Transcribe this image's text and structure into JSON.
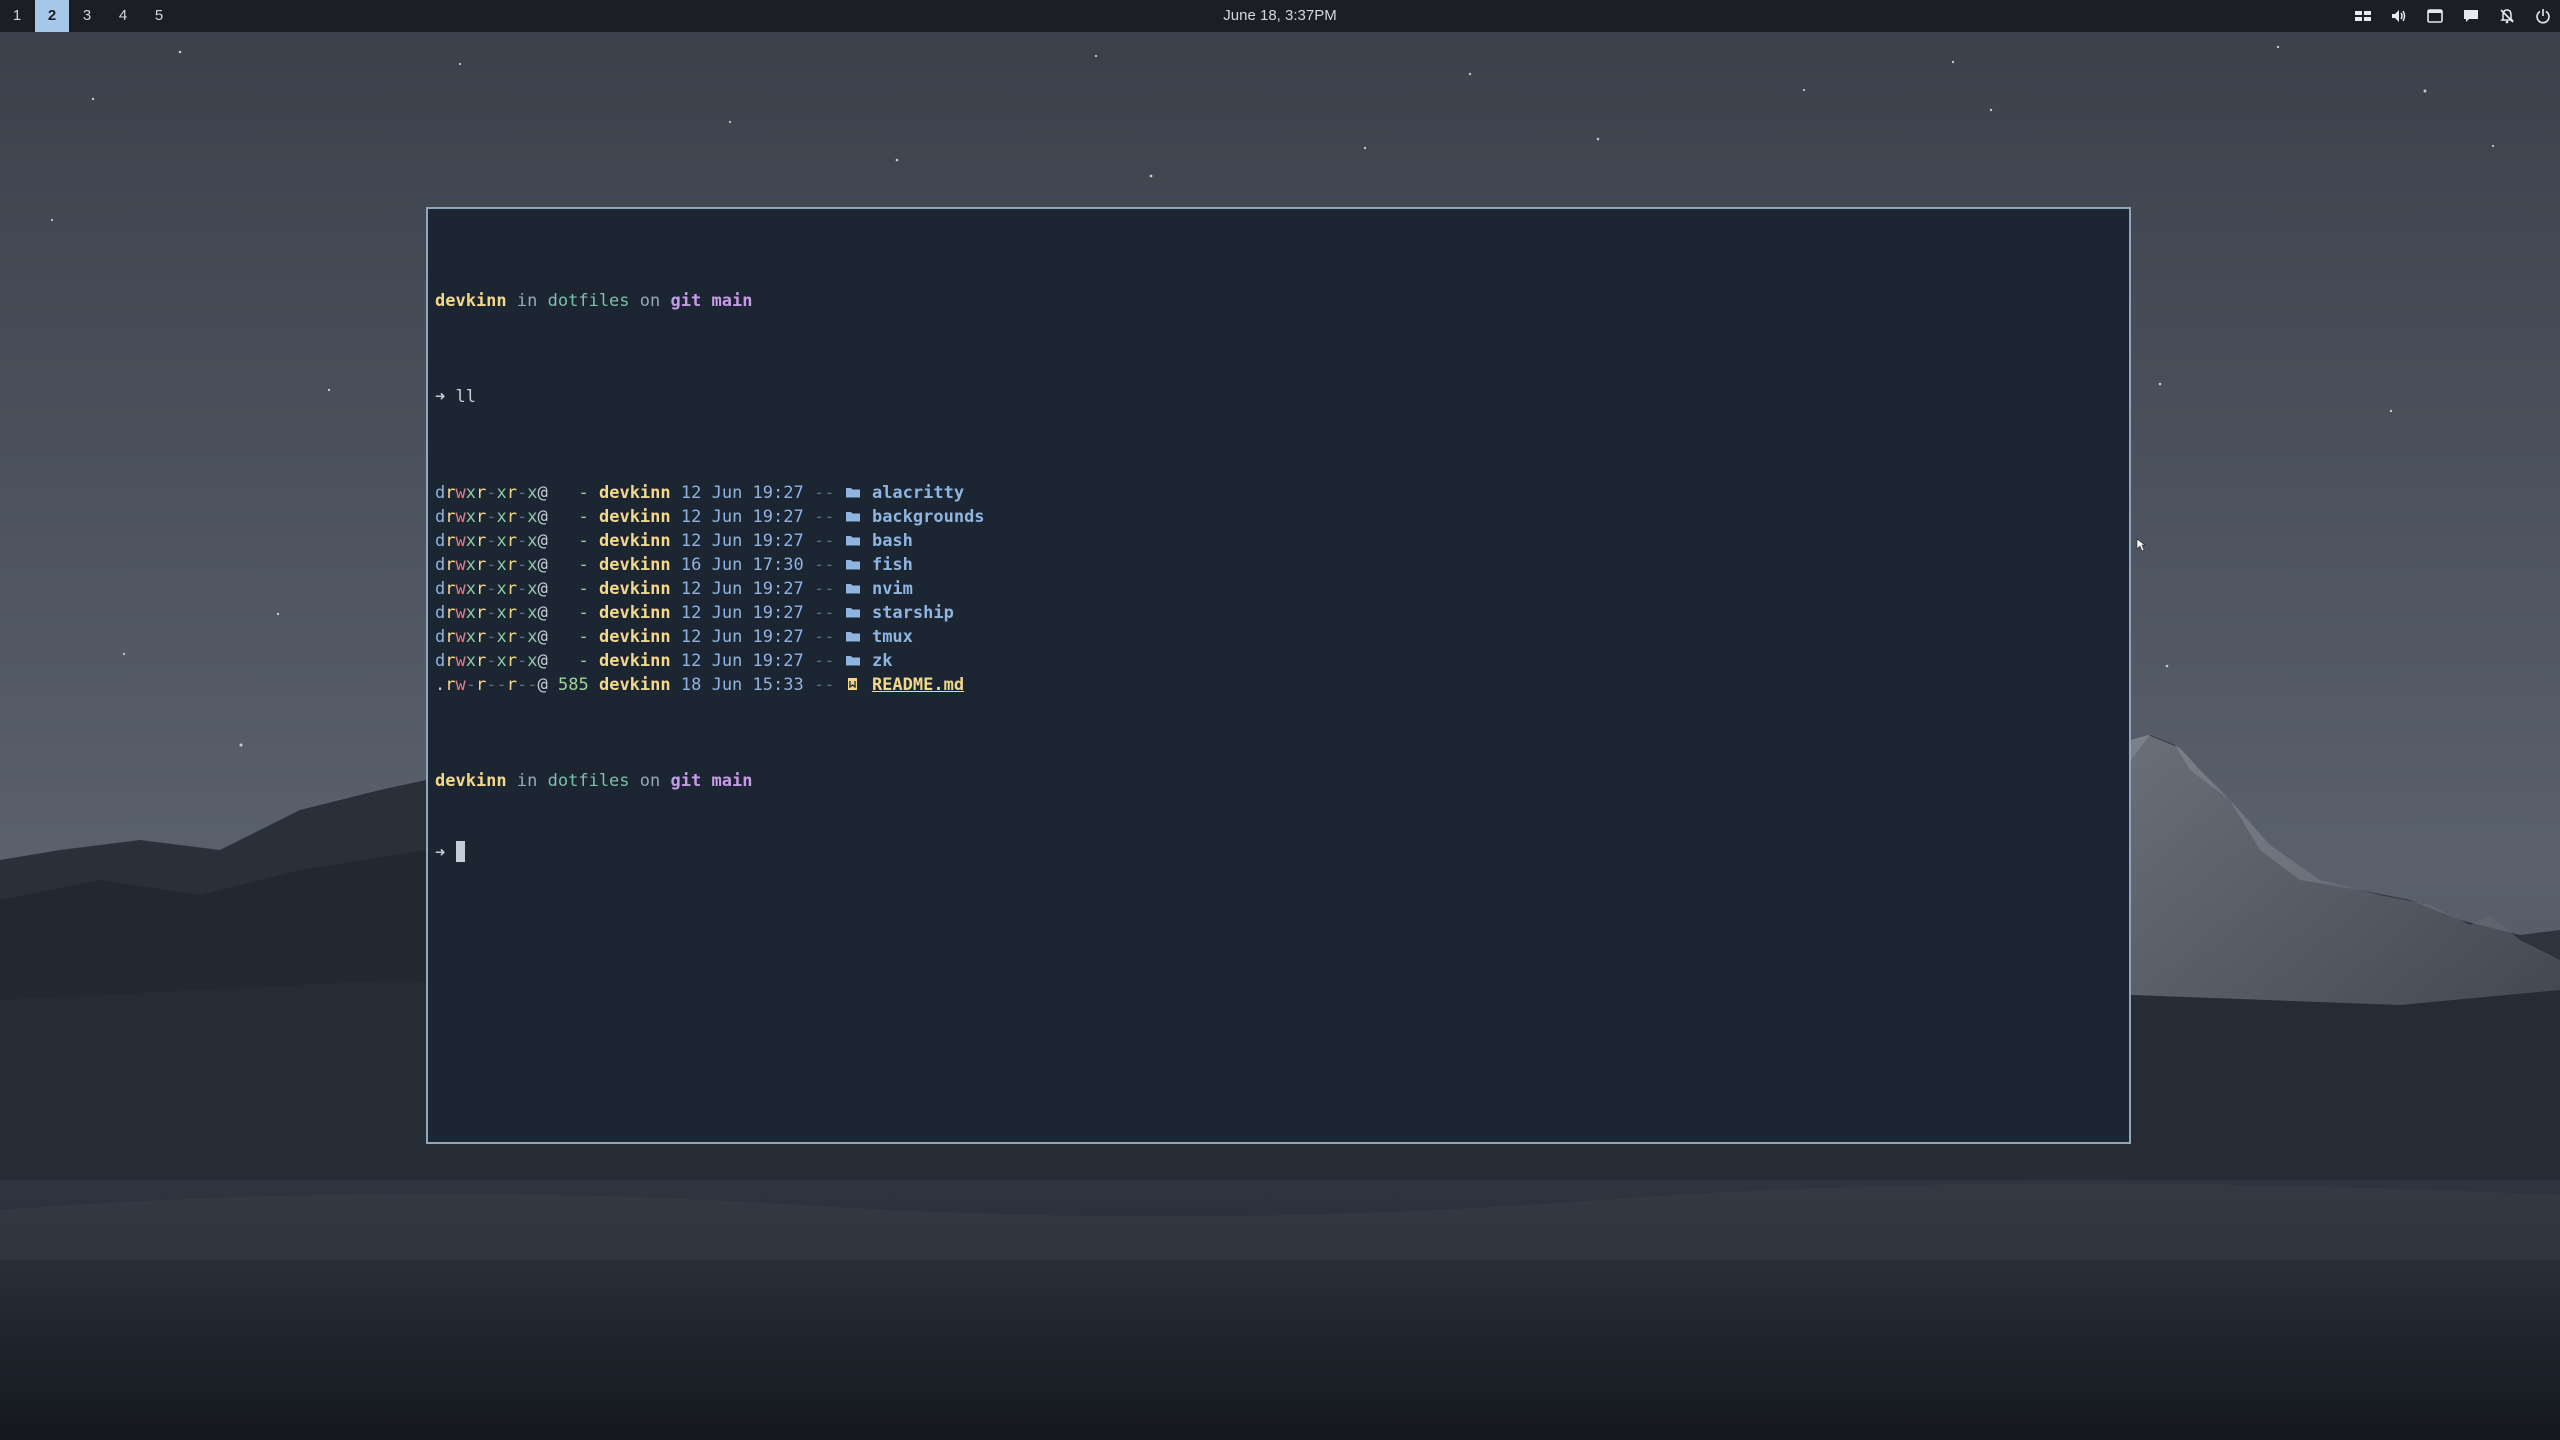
{
  "topbar": {
    "workspaces": [
      "1",
      "2",
      "3",
      "4",
      "5"
    ],
    "active_workspace": "2",
    "clock": "June 18, 3:37PM",
    "tray_icons": [
      "layout-icon",
      "volume-icon",
      "window-icon",
      "chat-icon",
      "notifications-off-icon",
      "power-icon"
    ]
  },
  "terminal": {
    "prompt1": {
      "user": "devkinn",
      "in": "in",
      "dir": "dotfiles",
      "on": "on",
      "git": "git",
      "branch": "main"
    },
    "command": {
      "arrow": "➜",
      "text": "ll"
    },
    "rows": [
      {
        "perm_d": "d",
        "perm_r1": "r",
        "perm_w": "w",
        "perm_x1": "x",
        "perm_r2": "r",
        "perm_dash2": "-",
        "perm_x2": "x",
        "perm_r3": "r",
        "perm_dash3": "-",
        "perm_x3": "x",
        "at": "@",
        "size": "-",
        "owner": "devkinn",
        "date": "12 Jun 19:27",
        "git": "--",
        "name": "alacritty",
        "kind": "dir"
      },
      {
        "perm_d": "d",
        "perm_r1": "r",
        "perm_w": "w",
        "perm_x1": "x",
        "perm_r2": "r",
        "perm_dash2": "-",
        "perm_x2": "x",
        "perm_r3": "r",
        "perm_dash3": "-",
        "perm_x3": "x",
        "at": "@",
        "size": "-",
        "owner": "devkinn",
        "date": "12 Jun 19:27",
        "git": "--",
        "name": "backgrounds",
        "kind": "dir"
      },
      {
        "perm_d": "d",
        "perm_r1": "r",
        "perm_w": "w",
        "perm_x1": "x",
        "perm_r2": "r",
        "perm_dash2": "-",
        "perm_x2": "x",
        "perm_r3": "r",
        "perm_dash3": "-",
        "perm_x3": "x",
        "at": "@",
        "size": "-",
        "owner": "devkinn",
        "date": "12 Jun 19:27",
        "git": "--",
        "name": "bash",
        "kind": "dir"
      },
      {
        "perm_d": "d",
        "perm_r1": "r",
        "perm_w": "w",
        "perm_x1": "x",
        "perm_r2": "r",
        "perm_dash2": "-",
        "perm_x2": "x",
        "perm_r3": "r",
        "perm_dash3": "-",
        "perm_x3": "x",
        "at": "@",
        "size": "-",
        "owner": "devkinn",
        "date": "16 Jun 17:30",
        "git": "--",
        "name": "fish",
        "kind": "dir"
      },
      {
        "perm_d": "d",
        "perm_r1": "r",
        "perm_w": "w",
        "perm_x1": "x",
        "perm_r2": "r",
        "perm_dash2": "-",
        "perm_x2": "x",
        "perm_r3": "r",
        "perm_dash3": "-",
        "perm_x3": "x",
        "at": "@",
        "size": "-",
        "owner": "devkinn",
        "date": "12 Jun 19:27",
        "git": "--",
        "name": "nvim",
        "kind": "dir"
      },
      {
        "perm_d": "d",
        "perm_r1": "r",
        "perm_w": "w",
        "perm_x1": "x",
        "perm_r2": "r",
        "perm_dash2": "-",
        "perm_x2": "x",
        "perm_r3": "r",
        "perm_dash3": "-",
        "perm_x3": "x",
        "at": "@",
        "size": "-",
        "owner": "devkinn",
        "date": "12 Jun 19:27",
        "git": "--",
        "name": "starship",
        "kind": "dir"
      },
      {
        "perm_d": "d",
        "perm_r1": "r",
        "perm_w": "w",
        "perm_x1": "x",
        "perm_r2": "r",
        "perm_dash2": "-",
        "perm_x2": "x",
        "perm_r3": "r",
        "perm_dash3": "-",
        "perm_x3": "x",
        "at": "@",
        "size": "-",
        "owner": "devkinn",
        "date": "12 Jun 19:27",
        "git": "--",
        "name": "tmux",
        "kind": "dir"
      },
      {
        "perm_d": "d",
        "perm_r1": "r",
        "perm_w": "w",
        "perm_x1": "x",
        "perm_r2": "r",
        "perm_dash2": "-",
        "perm_x2": "x",
        "perm_r3": "r",
        "perm_dash3": "-",
        "perm_x3": "x",
        "at": "@",
        "size": "-",
        "owner": "devkinn",
        "date": "12 Jun 19:27",
        "git": "--",
        "name": "zk",
        "kind": "dir"
      },
      {
        "perm_d": ".",
        "perm_r1": "r",
        "perm_w": "w",
        "perm_x1": "-",
        "perm_r2": "r",
        "perm_dash2": "-",
        "perm_x2": "-",
        "perm_r3": "r",
        "perm_dash3": "-",
        "perm_x3": "-",
        "at": "@",
        "size": "585",
        "owner": "devkinn",
        "date": "18 Jun 15:33",
        "git": "--",
        "name": "README.md",
        "kind": "file"
      }
    ],
    "prompt2": {
      "user": "devkinn",
      "in": "in",
      "dir": "dotfiles",
      "on": "on",
      "git": "git",
      "branch": "main"
    },
    "prompt2_arrow": "➜",
    "colors": {
      "background": "#1c2633",
      "border": "#8fa7bd",
      "foreground": "#c5cdd6"
    }
  }
}
